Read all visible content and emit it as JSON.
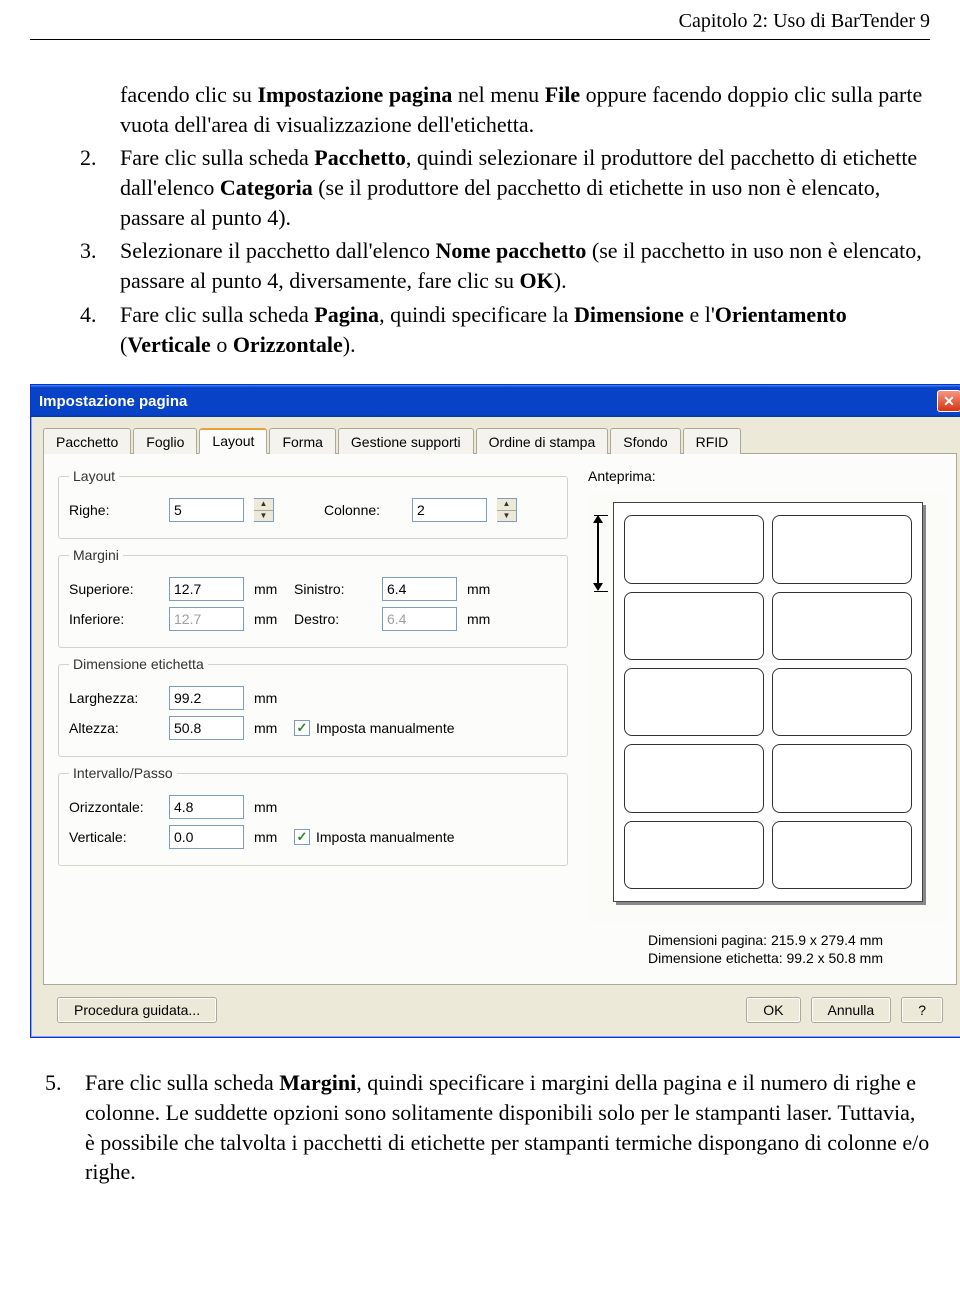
{
  "header": "Capitolo 2: Uso di BarTender   9",
  "paragraphs": {
    "p1_lead": "facendo clic su ",
    "p1_b1": "Impostazione pagina",
    "p1_mid": " nel menu ",
    "p1_b2": "File",
    "p1_tail": " oppure facendo doppio clic sulla parte vuota dell'area di visualizzazione dell'etichetta.",
    "p2_n": "2.",
    "p2_a": "Fare clic sulla scheda ",
    "p2_b1": "Pacchetto",
    "p2_b": ", quindi selezionare il produttore del pacchetto di etichette dall'elenco ",
    "p2_b2": "Categoria",
    "p2_c": " (se il produttore del pacchetto di etichette in uso non è elencato, passare al punto 4).",
    "p3_n": "3.",
    "p3_a": "Selezionare il pacchetto dall'elenco ",
    "p3_b1": "Nome pacchetto",
    "p3_b": " (se il pacchetto in uso non è elencato, passare al punto 4, diversamente, fare clic su ",
    "p3_b2": "OK",
    "p3_c": ").",
    "p4_n": "4.",
    "p4_a": "Fare clic sulla scheda ",
    "p4_b1": "Pagina",
    "p4_b": ", quindi specificare la ",
    "p4_b2": "Dimensione",
    "p4_c": " e l'",
    "p4_b3": "Orientamento",
    "p4_d": " (",
    "p4_b4": "Verticale",
    "p4_e": " o ",
    "p4_b5": "Orizzontale",
    "p4_f": ").",
    "p5_n": "5.",
    "p5_a": "Fare clic sulla scheda ",
    "p5_b1": "Margini",
    "p5_b": ", quindi specificare i margini della pagina e il numero di righe e colonne. Le suddette opzioni sono solitamente disponibili solo per le stampanti laser. Tuttavia, è possibile che talvolta i pacchetti di etichette per stampanti termiche dispongano di colonne e/o righe."
  },
  "dialog": {
    "title": "Impostazione pagina",
    "tabs": [
      "Pacchetto",
      "Foglio",
      "Layout",
      "Forma",
      "Gestione supporti",
      "Ordine di stampa",
      "Sfondo",
      "RFID"
    ],
    "active_tab": "Layout",
    "groups": {
      "layout": {
        "legend": "Layout",
        "rows": {
          "label": "Righe:",
          "value": "5",
          "cols_label": "Colonne:",
          "cols_value": "2"
        }
      },
      "margins": {
        "legend": "Margini",
        "top": {
          "label": "Superiore:",
          "value": "12.7",
          "unit": "mm"
        },
        "left": {
          "label": "Sinistro:",
          "value": "6.4",
          "unit": "mm"
        },
        "bottom": {
          "label": "Inferiore:",
          "value": "12.7",
          "unit": "mm"
        },
        "right": {
          "label": "Destro:",
          "value": "6.4",
          "unit": "mm"
        }
      },
      "labeldim": {
        "legend": "Dimensione etichetta",
        "w": {
          "label": "Larghezza:",
          "value": "99.2",
          "unit": "mm"
        },
        "h": {
          "label": "Altezza:",
          "value": "50.8",
          "unit": "mm"
        },
        "chk": "Imposta manualmente"
      },
      "gap": {
        "legend": "Intervallo/Passo",
        "h": {
          "label": "Orizzontale:",
          "value": "4.8",
          "unit": "mm"
        },
        "v": {
          "label": "Verticale:",
          "value": "0.0",
          "unit": "mm"
        },
        "chk": "Imposta manualmente"
      }
    },
    "preview": {
      "label": "Anteprima:",
      "page_dims": "Dimensioni pagina:  215.9 x 279.4  mm",
      "label_dims": "Dimensione etichetta:  99.2 x 50.8  mm"
    },
    "buttons": {
      "wizard": "Procedura guidata...",
      "ok": "OK",
      "cancel": "Annulla",
      "help": "?"
    }
  }
}
